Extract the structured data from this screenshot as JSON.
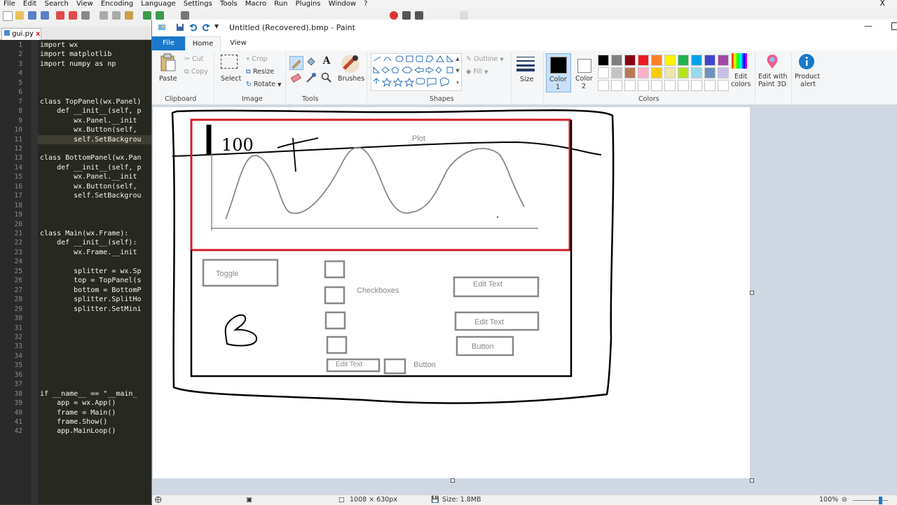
{
  "npp": {
    "menu": [
      "File",
      "Edit",
      "Search",
      "View",
      "Encoding",
      "Language",
      "Settings",
      "Tools",
      "Macro",
      "Run",
      "Plugins",
      "Window",
      "?"
    ],
    "close": "X",
    "tab": {
      "label": "gui.py",
      "close": "x"
    },
    "lines": [
      {
        "n": "1",
        "t": "import wx"
      },
      {
        "n": "2",
        "t": "import matplotlib"
      },
      {
        "n": "3",
        "t": "import numpy as np"
      },
      {
        "n": "4",
        "t": ""
      },
      {
        "n": "5",
        "t": ""
      },
      {
        "n": "6",
        "t": ""
      },
      {
        "n": "7",
        "t": "class TopPanel(wx.Panel)"
      },
      {
        "n": "8",
        "t": "    def __init__(self, p"
      },
      {
        "n": "9",
        "t": "        wx.Panel.__init"
      },
      {
        "n": "10",
        "t": "        wx.Button(self,"
      },
      {
        "n": "11",
        "t": "        self.SetBackgrou"
      },
      {
        "n": "12",
        "t": ""
      },
      {
        "n": "13",
        "t": "class BottomPanel(wx.Pan"
      },
      {
        "n": "14",
        "t": "    def __init__(self, p"
      },
      {
        "n": "15",
        "t": "        wx.Panel.__init"
      },
      {
        "n": "16",
        "t": "        wx.Button(self,"
      },
      {
        "n": "17",
        "t": "        self.SetBackgrou"
      },
      {
        "n": "18",
        "t": ""
      },
      {
        "n": "19",
        "t": ""
      },
      {
        "n": "20",
        "t": ""
      },
      {
        "n": "21",
        "t": "class Main(wx.Frame):"
      },
      {
        "n": "22",
        "t": "    def __init__(self):"
      },
      {
        "n": "23",
        "t": "        wx.Frame.__init"
      },
      {
        "n": "24",
        "t": ""
      },
      {
        "n": "25",
        "t": "        splitter = wx.Sp"
      },
      {
        "n": "26",
        "t": "        top = TopPanel(s"
      },
      {
        "n": "27",
        "t": "        bottom = BottomP"
      },
      {
        "n": "28",
        "t": "        splitter.SplitHo"
      },
      {
        "n": "29",
        "t": "        splitter.SetMini"
      },
      {
        "n": "30",
        "t": ""
      },
      {
        "n": "31",
        "t": ""
      },
      {
        "n": "32",
        "t": ""
      },
      {
        "n": "33",
        "t": ""
      },
      {
        "n": "34",
        "t": ""
      },
      {
        "n": "35",
        "t": ""
      },
      {
        "n": "36",
        "t": ""
      },
      {
        "n": "37",
        "t": ""
      },
      {
        "n": "38",
        "t": "if __name__ == \"__main_"
      },
      {
        "n": "39",
        "t": "    app = wx.App()"
      },
      {
        "n": "40",
        "t": "    frame = Main()"
      },
      {
        "n": "41",
        "t": "    frame.Show()"
      },
      {
        "n": "42",
        "t": "    app.MainLoop()"
      }
    ]
  },
  "paint": {
    "title": "Untitled (Recovered).bmp - Paint",
    "tabs": {
      "file": "File",
      "home": "Home",
      "view": "View"
    },
    "ribbon": {
      "paste": "Paste",
      "cut": "Cut",
      "copy": "Copy",
      "clipboard": "Clipboard",
      "select": "Select",
      "crop": "Crop",
      "resize": "Resize",
      "rotate": "Rotate",
      "image": "Image",
      "tools": "Tools",
      "brushes": "Brushes",
      "outline": "Outline",
      "fill": "Fill",
      "shapes": "Shapes",
      "size": "Size",
      "color1": "Color",
      "color1_num": "1",
      "color2": "Color",
      "color2_num": "2",
      "edit_colors": "Edit",
      "edit_colors2": "colors",
      "colors": "Colors",
      "paint3d": "Edit with",
      "paint3d2": "Paint 3D",
      "product_alert": "Product",
      "product_alert2": "alert"
    },
    "palette_row1": [
      "#000000",
      "#7f7f7f",
      "#880015",
      "#ed1c24",
      "#ff7f27",
      "#fff200",
      "#22b14c",
      "#00a2e8",
      "#3f48cc",
      "#a349a4"
    ],
    "palette_row2": [
      "#ffffff",
      "#c3c3c3",
      "#b97a57",
      "#ffaec9",
      "#ffc90e",
      "#efe4b0",
      "#b5e61d",
      "#99d9ea",
      "#7092be",
      "#c8bfe7"
    ],
    "status": {
      "dimensions": "1008 × 630px",
      "size": "Size: 1.8MB",
      "zoom": "100%"
    },
    "sketch": {
      "plot_label": "Plot",
      "y_value": "100",
      "toggle": "Toggle",
      "checkboxes": "Checkboxes",
      "edit_text_1": "Edit Text",
      "edit_text_2": "Edit Text",
      "button_1": "Button",
      "edit_text_3": "Edit Text",
      "button_2": "Button"
    }
  }
}
